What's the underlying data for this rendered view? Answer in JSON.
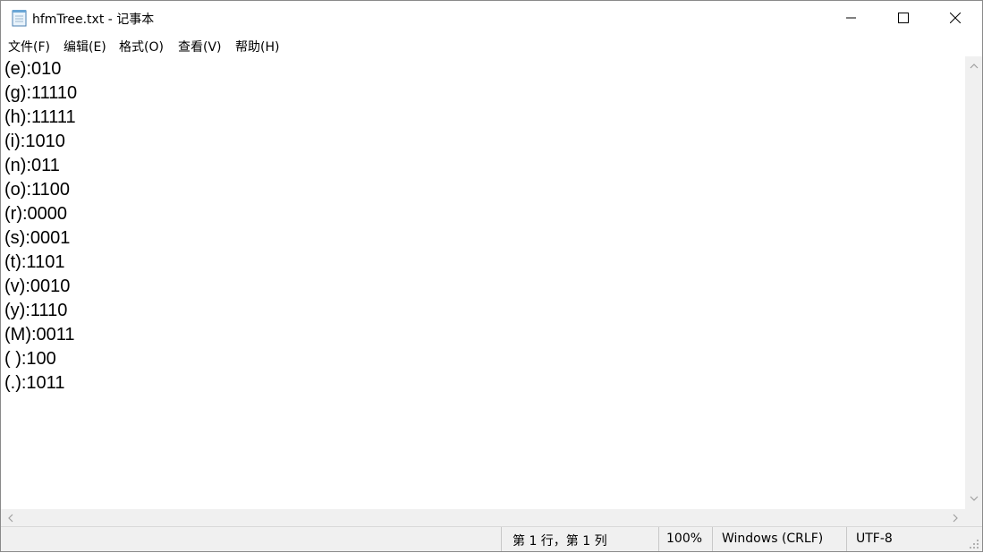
{
  "window": {
    "title": "hfmTree.txt - 记事本",
    "app_icon": "notepad-icon"
  },
  "menu": [
    {
      "label": "文件(F)"
    },
    {
      "label": "编辑(E)"
    },
    {
      "label": "格式(O)"
    },
    {
      "label": "查看(V)"
    },
    {
      "label": "帮助(H)"
    }
  ],
  "editor": {
    "lines": [
      "(e):010",
      "(g):11110",
      "(h):11111",
      "(i):1010",
      "(n):011",
      "(o):1100",
      "(r):0000",
      "(s):0001",
      "(t):1101",
      "(v):0010",
      "(y):1110",
      "(M):0011",
      "( ):100",
      "(.):1011"
    ]
  },
  "status": {
    "position": "第 1 行，第 1 列",
    "zoom": "100%",
    "line_ending": "Windows (CRLF)",
    "encoding": "UTF-8"
  }
}
